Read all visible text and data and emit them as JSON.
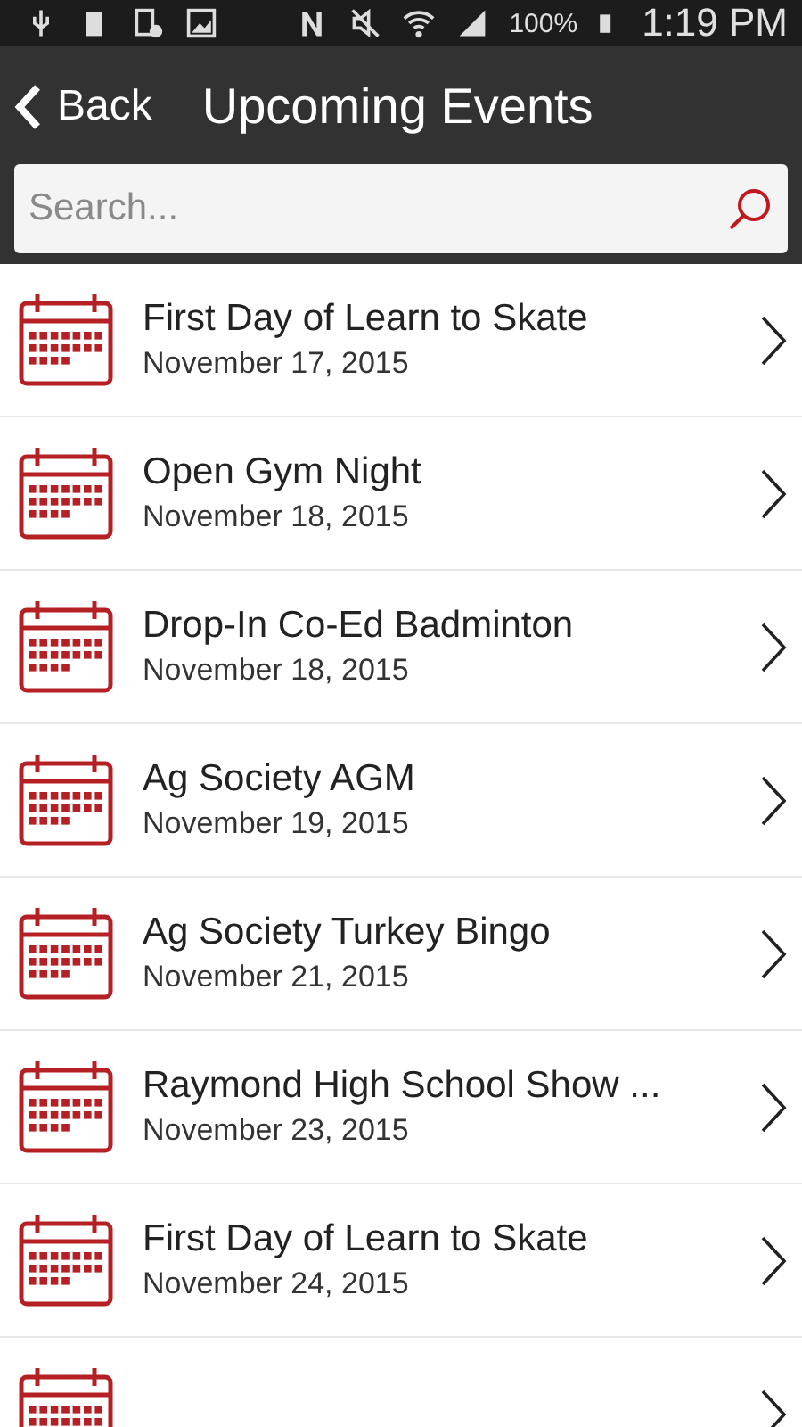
{
  "status_bar": {
    "battery_percent": "100%",
    "time": "1:19 PM"
  },
  "header": {
    "back_label": "Back",
    "title": "Upcoming Events"
  },
  "search": {
    "placeholder": "Search..."
  },
  "events": [
    {
      "kind": "event",
      "title": "First Day of Learn to Skate",
      "date": "November 17, 2015"
    },
    {
      "kind": "event",
      "title": "Open Gym Night",
      "date": "November 18, 2015"
    },
    {
      "kind": "event",
      "title": "Drop-In Co-Ed Badminton",
      "date": "November 18, 2015"
    },
    {
      "kind": "event",
      "title": "Ag Society AGM",
      "date": "November 19, 2015"
    },
    {
      "kind": "event",
      "title": "Ag Society Turkey Bingo",
      "date": "November 21, 2015"
    },
    {
      "kind": "event",
      "title": "Raymond High School Show ...",
      "date": "November 23, 2015"
    },
    {
      "kind": "event",
      "title": "First Day of Learn to Skate",
      "date": "November 24, 2015"
    },
    {
      "kind": "cut_off"
    }
  ]
}
